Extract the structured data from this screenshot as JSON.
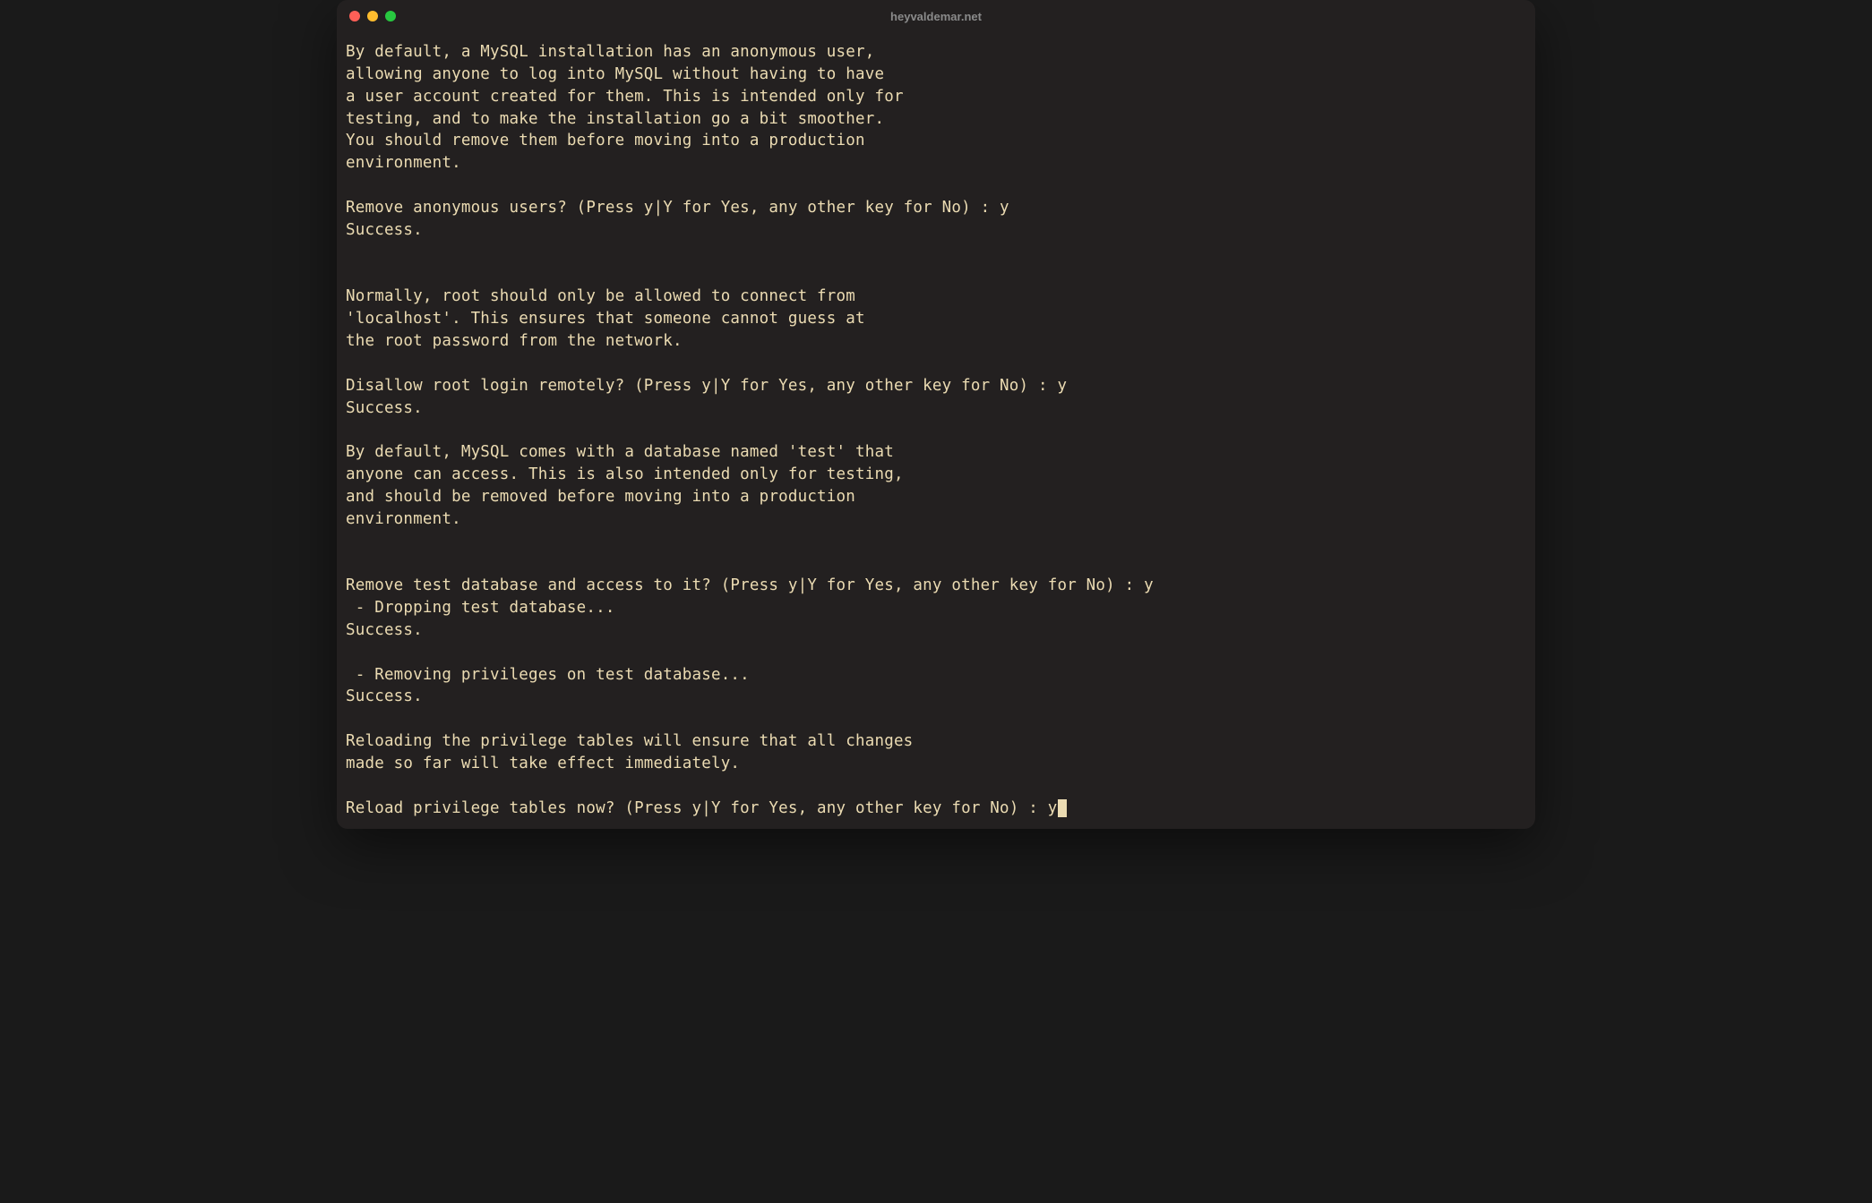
{
  "window": {
    "title": "heyvaldemar.net"
  },
  "terminal": {
    "lines": [
      "By default, a MySQL installation has an anonymous user,",
      "allowing anyone to log into MySQL without having to have",
      "a user account created for them. This is intended only for",
      "testing, and to make the installation go a bit smoother.",
      "You should remove them before moving into a production",
      "environment.",
      "",
      "Remove anonymous users? (Press y|Y for Yes, any other key for No) : y",
      "Success.",
      "",
      "",
      "Normally, root should only be allowed to connect from",
      "'localhost'. This ensures that someone cannot guess at",
      "the root password from the network.",
      "",
      "Disallow root login remotely? (Press y|Y for Yes, any other key for No) : y",
      "Success.",
      "",
      "By default, MySQL comes with a database named 'test' that",
      "anyone can access. This is also intended only for testing,",
      "and should be removed before moving into a production",
      "environment.",
      "",
      "",
      "Remove test database and access to it? (Press y|Y for Yes, any other key for No) : y",
      " - Dropping test database...",
      "Success.",
      "",
      " - Removing privileges on test database...",
      "Success.",
      "",
      "Reloading the privilege tables will ensure that all changes",
      "made so far will take effect immediately.",
      ""
    ],
    "current_prompt": "Reload privilege tables now? (Press y|Y for Yes, any other key for No) : y"
  }
}
